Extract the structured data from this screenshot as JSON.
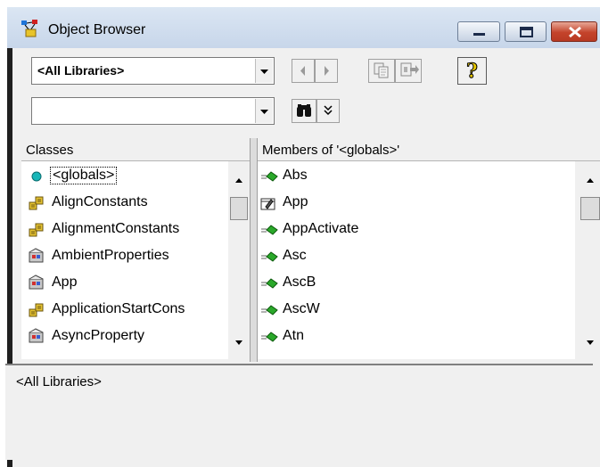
{
  "window": {
    "title": "Object Browser"
  },
  "toolbar": {
    "library_value": "<All Libraries>",
    "search_value": "",
    "help_glyph": "?"
  },
  "classes": {
    "header": "Classes",
    "items": [
      {
        "label": "<globals>",
        "icon": "globals-dot-icon"
      },
      {
        "label": "AlignConstants",
        "icon": "enum-icon"
      },
      {
        "label": "AlignmentConstants",
        "icon": "enum-icon"
      },
      {
        "label": "AmbientProperties",
        "icon": "class-icon"
      },
      {
        "label": "App",
        "icon": "class-icon"
      },
      {
        "label": "ApplicationStartCons",
        "icon": "enum-icon"
      },
      {
        "label": "AsyncProperty",
        "icon": "class-icon"
      }
    ]
  },
  "members": {
    "header": "Members of '<globals>'",
    "items": [
      {
        "label": "Abs",
        "icon": "method-icon"
      },
      {
        "label": "App",
        "icon": "property-icon"
      },
      {
        "label": "AppActivate",
        "icon": "method-icon"
      },
      {
        "label": "Asc",
        "icon": "method-icon"
      },
      {
        "label": "AscB",
        "icon": "method-icon"
      },
      {
        "label": "AscW",
        "icon": "method-icon"
      },
      {
        "label": "Atn",
        "icon": "method-icon"
      }
    ]
  },
  "details": {
    "text": "<All Libraries>"
  },
  "colors": {
    "selection_border": "#000000",
    "close_button": "#c4432b",
    "window_frame": "#cfdbea"
  }
}
